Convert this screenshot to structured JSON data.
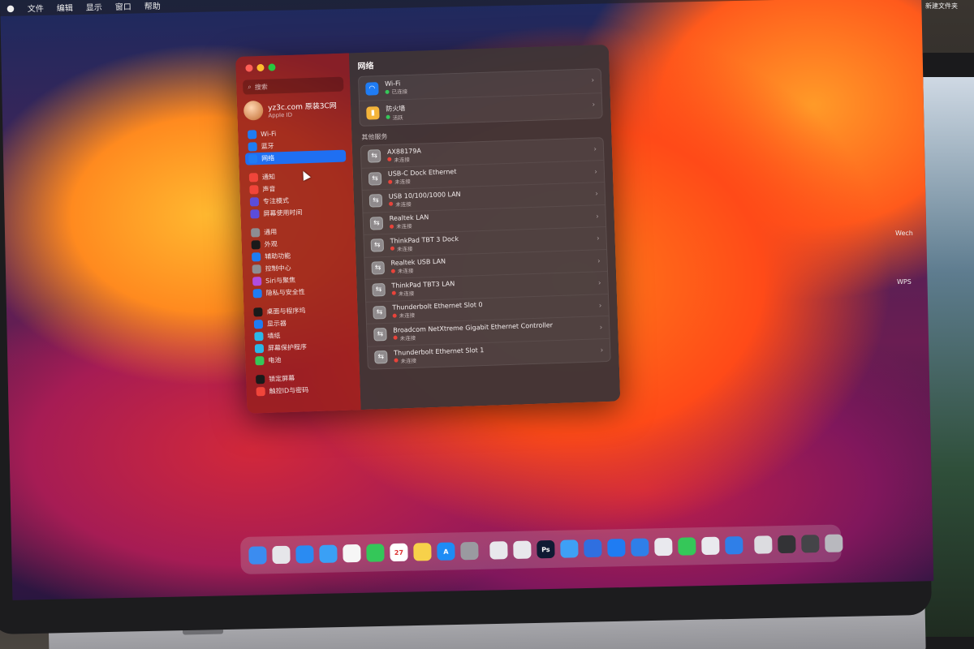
{
  "menubar": {
    "apple": "",
    "items": [
      "文件",
      "编辑",
      "显示",
      "窗口",
      "帮助"
    ]
  },
  "desktop": {
    "folder_label": "新建文件夹",
    "labels": [
      "Wech",
      "WPS"
    ]
  },
  "search": {
    "placeholder": "搜索"
  },
  "account": {
    "name": "yz3c.com 原装3C网",
    "sub": "Apple ID"
  },
  "sidebar": {
    "items": [
      {
        "label": "Wi-Fi",
        "color": "#1f7cf3",
        "active": false
      },
      {
        "label": "蓝牙",
        "color": "#1f7cf3",
        "active": false
      },
      {
        "label": "网络",
        "color": "#1f7cf3",
        "active": true
      },
      {
        "label": "通知",
        "color": "#f0453a",
        "active": false,
        "gap": true
      },
      {
        "label": "声音",
        "color": "#f0453a",
        "active": false
      },
      {
        "label": "专注模式",
        "color": "#5b4ddb",
        "active": false
      },
      {
        "label": "屏幕使用时间",
        "color": "#5b4ddb",
        "active": false
      },
      {
        "label": "通用",
        "color": "#8d8d92",
        "active": false,
        "gap": true
      },
      {
        "label": "外观",
        "color": "#1a1a1a",
        "active": false
      },
      {
        "label": "辅助功能",
        "color": "#1f7cf3",
        "active": false
      },
      {
        "label": "控制中心",
        "color": "#8d8d92",
        "active": false
      },
      {
        "label": "Siri与聚焦",
        "color": "#b04de0",
        "active": false
      },
      {
        "label": "隐私与安全性",
        "color": "#1f7cf3",
        "active": false
      },
      {
        "label": "桌面与程序坞",
        "color": "#1a1a1a",
        "active": false,
        "gap": true
      },
      {
        "label": "显示器",
        "color": "#1f7cf3",
        "active": false
      },
      {
        "label": "墙纸",
        "color": "#2bb7e8",
        "active": false
      },
      {
        "label": "屏幕保护程序",
        "color": "#2bb7e8",
        "active": false
      },
      {
        "label": "电池",
        "color": "#35c759",
        "active": false
      },
      {
        "label": "锁定屏幕",
        "color": "#1a1a1a",
        "active": false,
        "gap": true
      },
      {
        "label": "触控ID与密码",
        "color": "#f0453a",
        "active": false
      }
    ]
  },
  "content": {
    "title": "网络",
    "primary": [
      {
        "name": "Wi-Fi",
        "status": "已连接",
        "status_color": "#35c759",
        "icon_color": "#1f7cf3",
        "icon": "wifi-icon"
      },
      {
        "name": "防火墙",
        "status": "活跃",
        "status_color": "#35c759",
        "icon_color": "#f4b43a",
        "icon": "firewall-icon"
      }
    ],
    "other_label": "其他服务",
    "services": [
      {
        "name": "AX88179A",
        "status": "未连接"
      },
      {
        "name": "USB-C Dock Ethernet",
        "status": "未连接"
      },
      {
        "name": "USB 10/100/1000 LAN",
        "status": "未连接"
      },
      {
        "name": "Realtek LAN",
        "status": "未连接"
      },
      {
        "name": "ThinkPad TBT 3 Dock",
        "status": "未连接"
      },
      {
        "name": "Realtek USB LAN",
        "status": "未连接"
      },
      {
        "name": "ThinkPad TBT3 LAN",
        "status": "未连接"
      },
      {
        "name": "Thunderbolt Ethernet Slot 0",
        "status": "未连接"
      },
      {
        "name": "Broadcom NetXtreme Gigabit Ethernet Controller",
        "status": "未连接"
      },
      {
        "name": "Thunderbolt Ethernet Slot 1",
        "status": "未连接"
      }
    ],
    "disconnected_color": "#e8433a"
  },
  "dock": {
    "apps": [
      {
        "name": "finder",
        "color": "#3b8cf0",
        "text": ""
      },
      {
        "name": "launchpad",
        "color": "#e6e6ea",
        "text": ""
      },
      {
        "name": "safari",
        "color": "#2a8bf2",
        "text": ""
      },
      {
        "name": "mail",
        "color": "#3aa0f5",
        "text": ""
      },
      {
        "name": "photos",
        "color": "#f6f6f6",
        "text": ""
      },
      {
        "name": "facetime",
        "color": "#34c759",
        "text": ""
      },
      {
        "name": "calendar",
        "color": "#ffffff",
        "text": "27"
      },
      {
        "name": "notes",
        "color": "#f7d14a",
        "text": ""
      },
      {
        "name": "app-store",
        "color": "#1d8cf5",
        "text": "A"
      },
      {
        "name": "system-settings",
        "color": "#9a9aa0",
        "text": ""
      },
      {
        "name": "sep"
      },
      {
        "name": "preview",
        "color": "#e8e8ec",
        "text": ""
      },
      {
        "name": "app-red",
        "color": "#e8e8ec",
        "text": ""
      },
      {
        "name": "photoshop",
        "color": "#0f1a33",
        "text": "Ps"
      },
      {
        "name": "qq",
        "color": "#3ea0f5",
        "text": ""
      },
      {
        "name": "netnewswire",
        "color": "#2f6fe0",
        "text": ""
      },
      {
        "name": "grid-app",
        "color": "#1f7cf3",
        "text": ""
      },
      {
        "name": "app-blue-1",
        "color": "#2f7fe8",
        "text": ""
      },
      {
        "name": "chrome",
        "color": "#e9e9ee",
        "text": ""
      },
      {
        "name": "wechat",
        "color": "#35c759",
        "text": ""
      },
      {
        "name": "chrome-2",
        "color": "#e9e9ee",
        "text": ""
      },
      {
        "name": "app-blue-2",
        "color": "#2f7fe8",
        "text": ""
      },
      {
        "name": "sep"
      },
      {
        "name": "folder-stack",
        "color": "#dcdce0",
        "text": ""
      },
      {
        "name": "screenshots",
        "color": "#333336",
        "text": ""
      },
      {
        "name": "screenshots-2",
        "color": "#444448",
        "text": ""
      },
      {
        "name": "trash",
        "color": "#b8b8be",
        "text": ""
      }
    ]
  }
}
